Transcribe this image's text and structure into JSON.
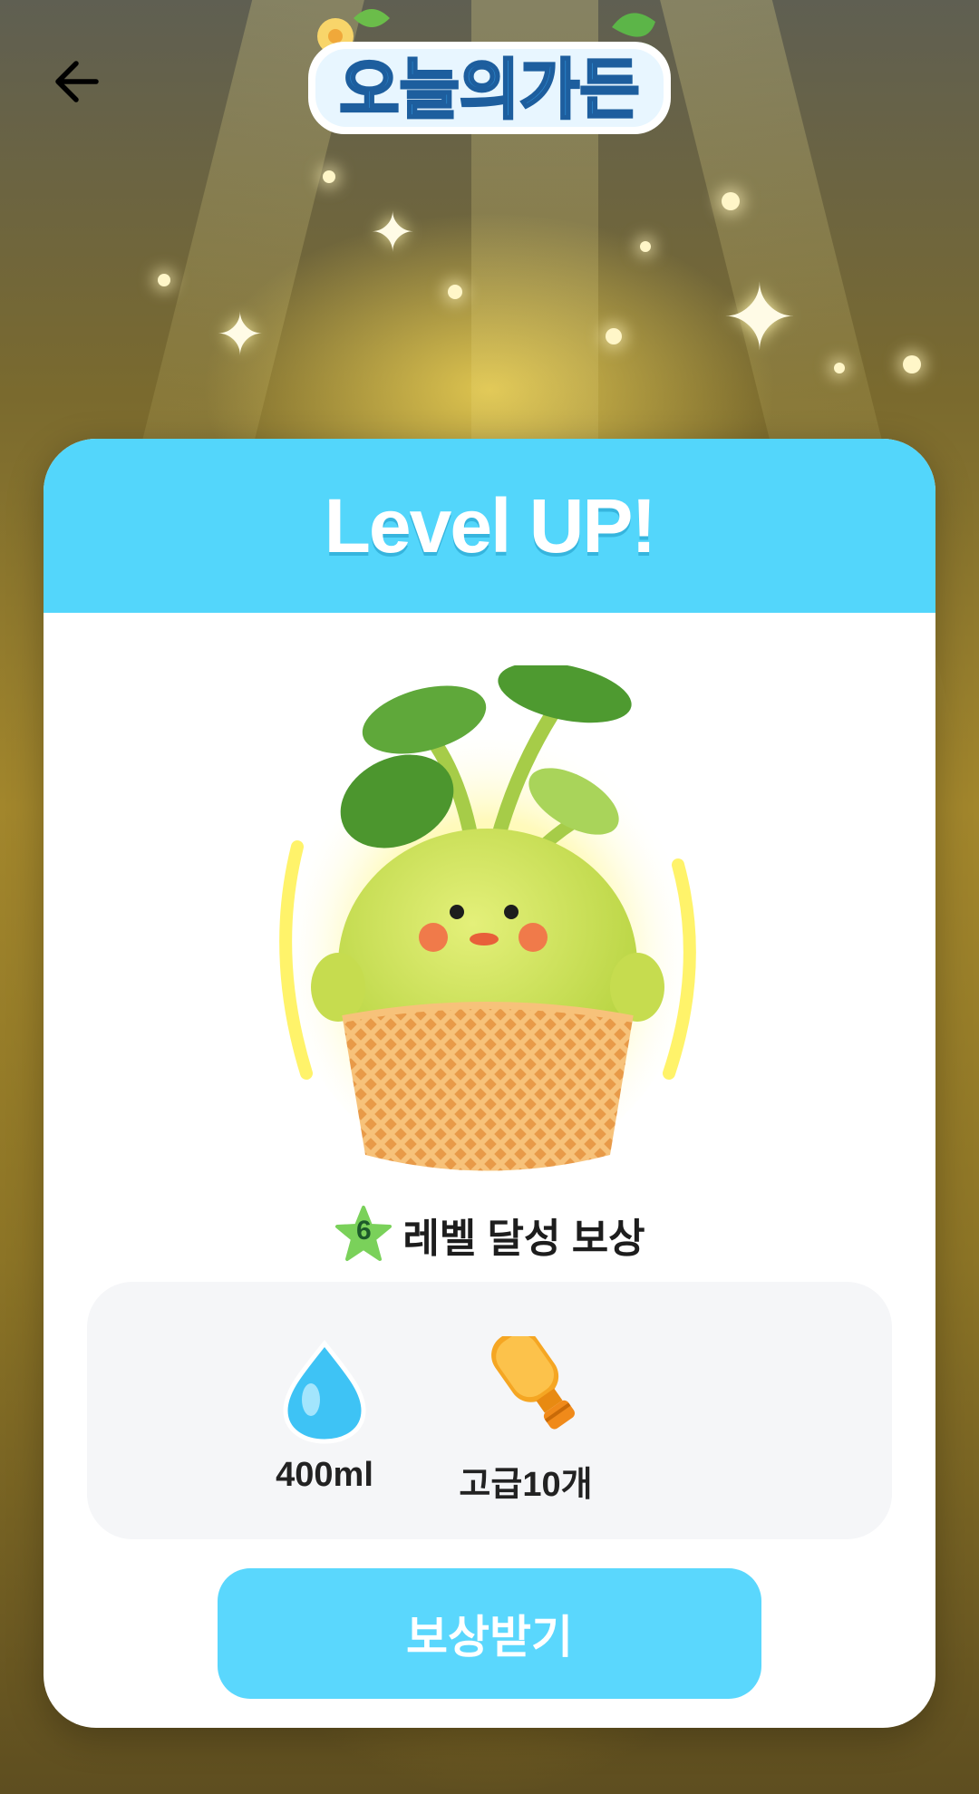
{
  "header": {
    "back_icon": "arrow-left-icon",
    "logo_text": "오늘의가든"
  },
  "card": {
    "title": "Level UP!",
    "level": "6",
    "reward_heading": "레벨 달성 보상",
    "rewards": [
      {
        "icon": "water-drop-icon",
        "label": "400ml"
      },
      {
        "icon": "fertilizer-bottle-icon",
        "label": "고급10개"
      }
    ],
    "claim_button": "보상받기"
  },
  "colors": {
    "accent": "#53d6fb",
    "button": "#5ad7fd",
    "level_star": "#7ad15a"
  }
}
